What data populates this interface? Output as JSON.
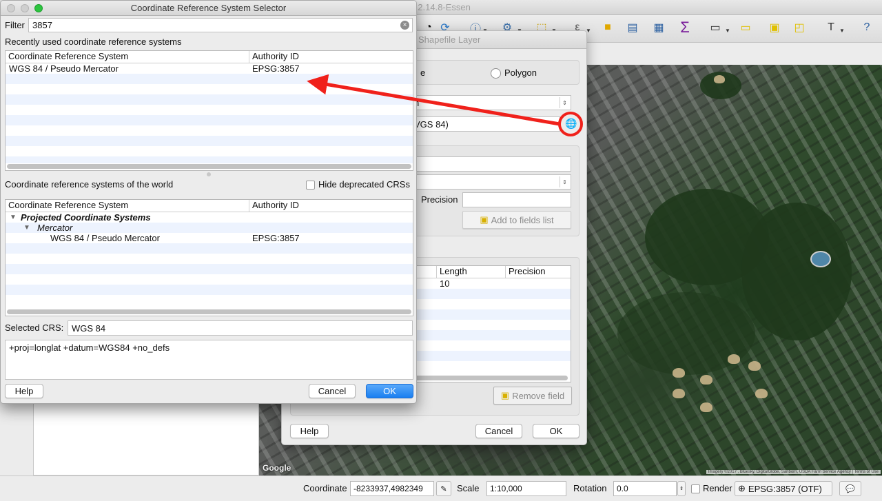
{
  "app": {
    "window_title": "QGIS 2.14.8-Essen",
    "window_title_visible": "S 2.14.8-Essen"
  },
  "toolbar": {
    "icons": [
      "identify-icon",
      "refresh-icon",
      "info-icon",
      "action-icon",
      "select-icon",
      "deselect-icon",
      "attribute-table-icon",
      "field-calculator-icon",
      "statistics-icon",
      "measure-icon",
      "annotation-icon",
      "text-annotation-icon",
      "help-icon"
    ]
  },
  "map": {
    "provider_logo": "Google",
    "attribution": "Imagery ©2017 , Bluesky, DigitalGlobe, Sanborn, USDA Farm Service Agency | Terms of Use"
  },
  "statusbar": {
    "coordinate_label": "Coordinate",
    "coordinate_value": "-8233937,4982349",
    "scale_label": "Scale",
    "scale_value": "1:10,000",
    "rotation_label": "Rotation",
    "rotation_value": "0.0",
    "render_label": "Render",
    "crs_value": "EPSG:3857 (OTF)"
  },
  "shapefile_dialog": {
    "title": "Shapefile Layer",
    "geometry_partial_label": "e",
    "polygon_label": "Polygon",
    "encoding_partial": "n",
    "crs_partial_value": "VGS 84)",
    "precision_label": "Precision",
    "add_to_fields_label": "Add to fields list",
    "table_headers": [
      "Length",
      "Precision"
    ],
    "table_row_length": "10",
    "remove_field_label": "Remove field",
    "help_label": "Help",
    "cancel_label": "Cancel",
    "ok_label": "OK"
  },
  "crs_dialog": {
    "title": "Coordinate Reference System Selector",
    "filter_label": "Filter",
    "filter_value": "3857",
    "recent_label": "Recently used coordinate reference systems",
    "col_crs": "Coordinate Reference System",
    "col_authority": "Authority ID",
    "recent_rows": [
      {
        "name": "WGS 84 / Pseudo Mercator",
        "authority": "EPSG:3857"
      }
    ],
    "world_label": "Coordinate reference systems of the world",
    "hide_deprecated_label": "Hide deprecated CRSs",
    "hide_deprecated_checked": false,
    "tree": {
      "group": "Projected Coordinate Systems",
      "subgroup": "Mercator",
      "item_name": "WGS 84 / Pseudo Mercator",
      "item_authority": "EPSG:3857"
    },
    "selected_crs_label": "Selected CRS:",
    "selected_crs_value": "WGS 84",
    "proj_string": "+proj=longlat +datum=WGS84 +no_defs",
    "help_label": "Help",
    "cancel_label": "Cancel",
    "ok_label": "OK"
  },
  "colors": {
    "annotation_red": "#f0211b",
    "ok_blue": "#1a7ff0",
    "row_stripe": "#edf3fe"
  }
}
